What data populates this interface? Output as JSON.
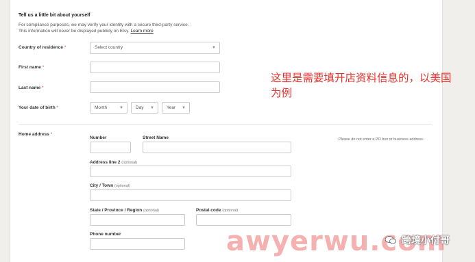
{
  "section": {
    "title": "Tell us a little bit about yourself",
    "intro_line1": "For compliance purposes, we may verify your identity with a secure third-party service.",
    "intro_line2": "This information will never be displayed publicly on Etsy.",
    "learn_more": "Learn more"
  },
  "required_mark": "*",
  "country": {
    "label": "Country of residence",
    "value": "Select country"
  },
  "first_name": {
    "label": "First name",
    "value": ""
  },
  "last_name": {
    "label": "Last name",
    "value": ""
  },
  "dob": {
    "label": "Your date of birth",
    "month": "Month",
    "day": "Day",
    "year": "Year"
  },
  "home_address": {
    "label": "Home address",
    "note": "Please do not enter a PO box or business address.",
    "number_label": "Number",
    "street_label": "Street Name",
    "line2_label": "Address line 2",
    "city_label": "City / Town",
    "state_label": "State / Province / Region",
    "postal_label": "Postal code",
    "phone_label": "Phone number",
    "optional": "(optional)"
  },
  "annotation": {
    "line1": "这里是需要填开店资料信息的，以美国",
    "line2": "为例"
  },
  "watermark": {
    "text": "awyerwu.com",
    "brand": "跨境小付哥"
  },
  "colors": {
    "required": "#d6402f",
    "annotation": "#e8322b",
    "watermark": "#e85050"
  }
}
